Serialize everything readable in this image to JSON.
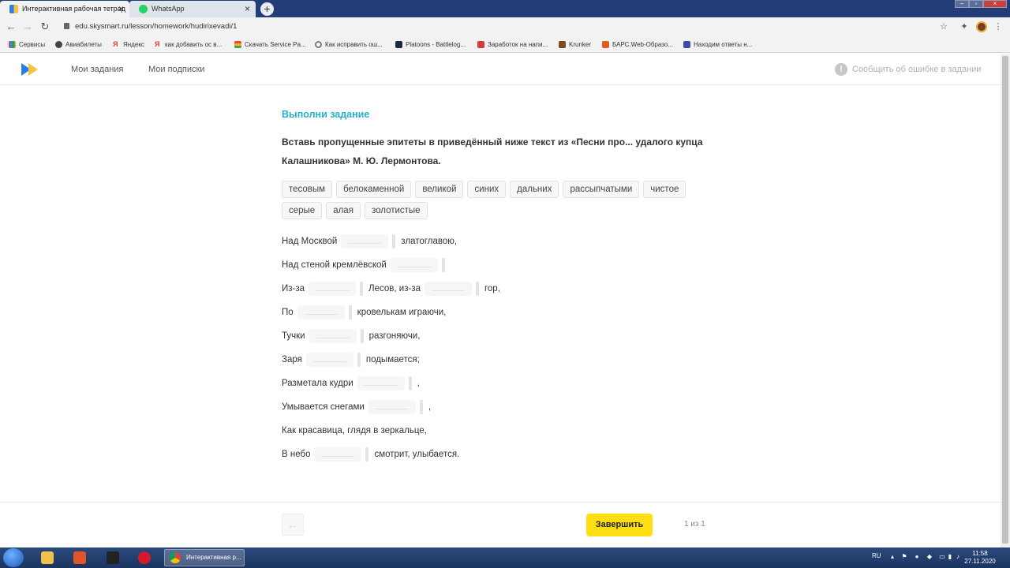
{
  "browser": {
    "tabs": [
      {
        "title": "Интерактивная рабочая тетрад",
        "icon": "skysmart-favicon",
        "active": true
      },
      {
        "title": "WhatsApp",
        "icon": "whatsapp-favicon",
        "active": false
      }
    ],
    "new_tab_label": "+",
    "url": "edu.skysmart.ru/lesson/homework/hudirixevadi/1",
    "bookmarks": [
      "Сервисы",
      "Авиабилеты",
      "Яндекс",
      "как добавить ос в...",
      "Скачать Service Pa...",
      "Как исправить ош...",
      "Platoons - Battlelog...",
      "Заработок на напи...",
      "Krunker",
      "БАРС.Web-Образо...",
      "Находим ответы н..."
    ]
  },
  "site": {
    "nav": {
      "my_tasks": "Мои задания",
      "my_subscriptions": "Мои подписки"
    },
    "report_error": "Сообщить об ошибке в задании"
  },
  "task": {
    "heading": "Выполни задание",
    "instruction": "Вставь пропущенные эпитеты в приведённый ниже текст из «Песни про... удалого купца Калашникова» М. Ю. Лермонтова.",
    "word_bank": [
      "тесовым",
      "белокаменной",
      "великой",
      "синих",
      "дальних",
      "рассыпчатыми",
      "чистое",
      "серые",
      "алая",
      "золотистые"
    ],
    "lines": [
      {
        "before": "Над Москвой",
        "after": "златоглавою,"
      },
      {
        "before": "Над стеной кремлёвской",
        "after": ""
      },
      {
        "before": "Из-за",
        "middle": "Лесов, из-за",
        "after": "гор,"
      },
      {
        "before": "По",
        "after": "кровелькам играючи,"
      },
      {
        "before": "Тучки",
        "after": "разгоняючи,"
      },
      {
        "before": "Заря",
        "after": "подымается;"
      },
      {
        "before": "Разметала кудри",
        "after": ","
      },
      {
        "before": "Умывается снегами",
        "after": ","
      },
      {
        "text": "Как красавица, глядя в зеркальце,"
      },
      {
        "before": "В небо",
        "after": "смотрит, улыбается."
      }
    ]
  },
  "footer": {
    "back_arrow": "←",
    "finish_button": "Завершить",
    "pager": "1 из 1"
  },
  "taskbar": {
    "active_window": "Интерактивная р...",
    "language": "RU",
    "time": "11:58",
    "date": "27.11.2020"
  },
  "colors": {
    "accent_heading": "#26b0cc",
    "finish_button": "#ffde14",
    "tabbar": "#233d77"
  }
}
